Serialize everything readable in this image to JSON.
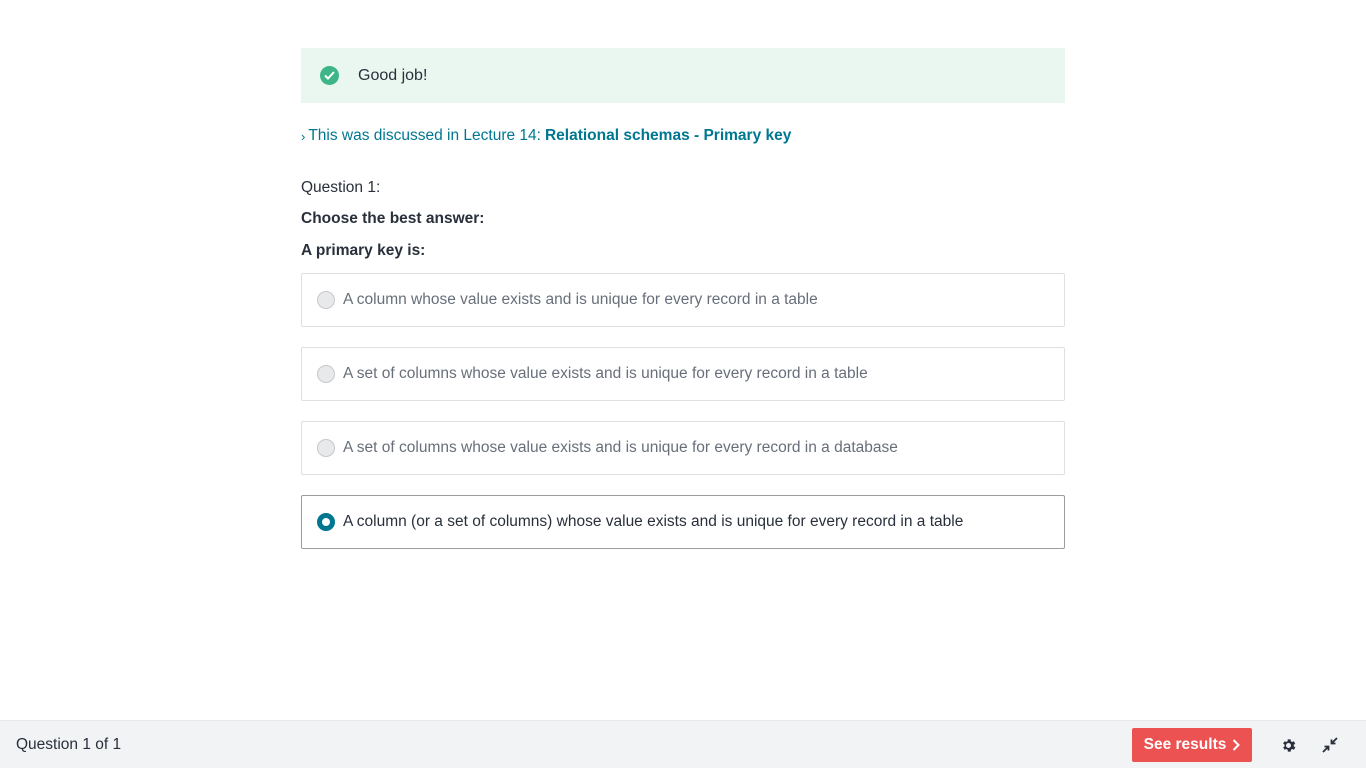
{
  "feedback": {
    "text": "Good job!",
    "icon": "check-circle-icon"
  },
  "lecture": {
    "prefix": "This was discussed in Lecture 14:",
    "title": "Relational schemas - Primary key"
  },
  "question": {
    "number": "Question 1:",
    "instructions": "Choose the best answer:",
    "prompt": "A primary key is:",
    "options": [
      {
        "label": "A column whose value exists and is unique for every record in a table",
        "selected": false
      },
      {
        "label": "A set of columns whose value exists and is unique for every record in a table",
        "selected": false
      },
      {
        "label": "A set of columns whose value exists and is unique for every record in a database",
        "selected": false
      },
      {
        "label": "A column (or a set of columns) whose value exists and is unique for every record in a table",
        "selected": true
      }
    ]
  },
  "footer": {
    "counter": "Question 1 of 1",
    "see_results_label": "See results",
    "icons": [
      "gear-icon",
      "collapse-icon"
    ]
  },
  "colors": {
    "accent": "#007791",
    "success": "#3eb588",
    "success_bg": "#e9f7f0",
    "cta": "#ec5252"
  }
}
